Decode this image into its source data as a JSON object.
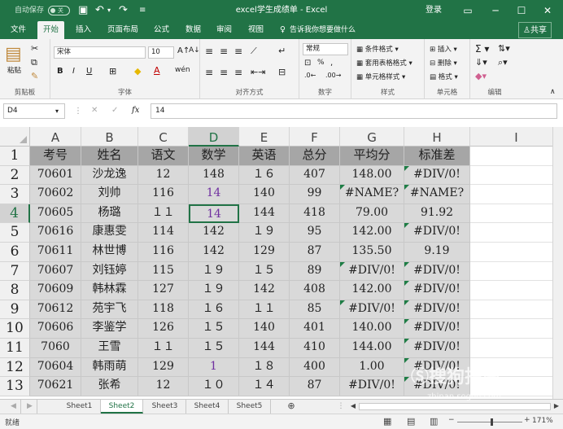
{
  "titlebar": {
    "autosave": "自动保存",
    "autosave_state": "关",
    "doc_title": "excel学生成绩单 - Excel",
    "login": "登录"
  },
  "tabs": [
    "文件",
    "开始",
    "插入",
    "页面布局",
    "公式",
    "数据",
    "审阅",
    "视图"
  ],
  "active_tab": "开始",
  "tell_me": "告诉我你想要做什么",
  "share": "共享",
  "ribbon": {
    "clipboard": {
      "paste": "粘贴",
      "label": "剪贴板"
    },
    "font": {
      "name": "宋体",
      "size": "10",
      "label": "字体"
    },
    "alignment": {
      "label": "对齐方式"
    },
    "number": {
      "format": "常规",
      "label": "数字"
    },
    "styles": {
      "conditional": "条件格式",
      "table": "套用表格格式",
      "cell_styles": "单元格样式",
      "label": "样式"
    },
    "cells": {
      "insert": "插入",
      "delete": "删除",
      "format": "格式",
      "label": "单元格"
    },
    "editing": {
      "label": "编辑"
    }
  },
  "formula_bar": {
    "name_box": "D4",
    "content": "14"
  },
  "columns": [
    "A",
    "B",
    "C",
    "D",
    "E",
    "F",
    "G",
    "H",
    "I"
  ],
  "selected_column": "D",
  "rows": [
    "1",
    "2",
    "3",
    "4",
    "5",
    "6",
    "7",
    "8",
    "9",
    "10",
    "11",
    "12",
    "13"
  ],
  "selected_row": "4",
  "table": [
    [
      "考号",
      "姓名",
      "语文",
      "数学",
      "英语",
      "总分",
      "平均分",
      "标准差"
    ],
    [
      "70601",
      "沙龙逸",
      "12",
      "148",
      "１６",
      "407",
      "148.00",
      "#DIV/0!"
    ],
    [
      "70602",
      "刘帅",
      "116",
      "14",
      "140",
      "99",
      "#NAME?",
      "#NAME?"
    ],
    [
      "70605",
      "杨璐",
      "１１",
      "14",
      "144",
      "418",
      "79.00",
      "91.92"
    ],
    [
      "70616",
      "康惠雯",
      "114",
      "142",
      "１９",
      "95",
      "142.00",
      "#DIV/0!"
    ],
    [
      "70611",
      "林世博",
      "116",
      "142",
      "129",
      "87",
      "135.50",
      "9.19"
    ],
    [
      "70607",
      "刘钰婷",
      "115",
      "１９",
      "１５",
      "89",
      "#DIV/0!",
      "#DIV/0!"
    ],
    [
      "70609",
      "韩林霖",
      "127",
      "１９",
      "142",
      "408",
      "142.00",
      "#DIV/0!"
    ],
    [
      "70612",
      "苑宇飞",
      "118",
      "１６",
      "１１",
      "85",
      "#DIV/0!",
      "#DIV/0!"
    ],
    [
      "70606",
      "李鉴学",
      "126",
      "１５",
      "140",
      "401",
      "140.00",
      "#DIV/0!"
    ],
    [
      "7060",
      "王雪",
      "１１",
      "１５",
      "144",
      "410",
      "144.00",
      "#DIV/0!"
    ],
    [
      "70604",
      "韩雨萌",
      "129",
      "1",
      "１８",
      "400",
      "1.00",
      "#DIV/0!"
    ],
    [
      "70621",
      "张希",
      "12",
      "１０",
      "１４",
      "87",
      "#DIV/0!",
      "#DIV/0!"
    ]
  ],
  "sheets": [
    "Sheet1",
    "Sheet2",
    "Sheet3",
    "Sheet4",
    "Sheet5"
  ],
  "active_sheet": "Sheet2",
  "status": {
    "ready": "就绪",
    "zoom": "171%"
  },
  "watermark": {
    "text": "搜狗指南",
    "url": "zhinan.sogou.com"
  },
  "colors": {
    "accent": "#217346",
    "purple_text": "#7030a0",
    "error_marker": "#1e7d45"
  }
}
